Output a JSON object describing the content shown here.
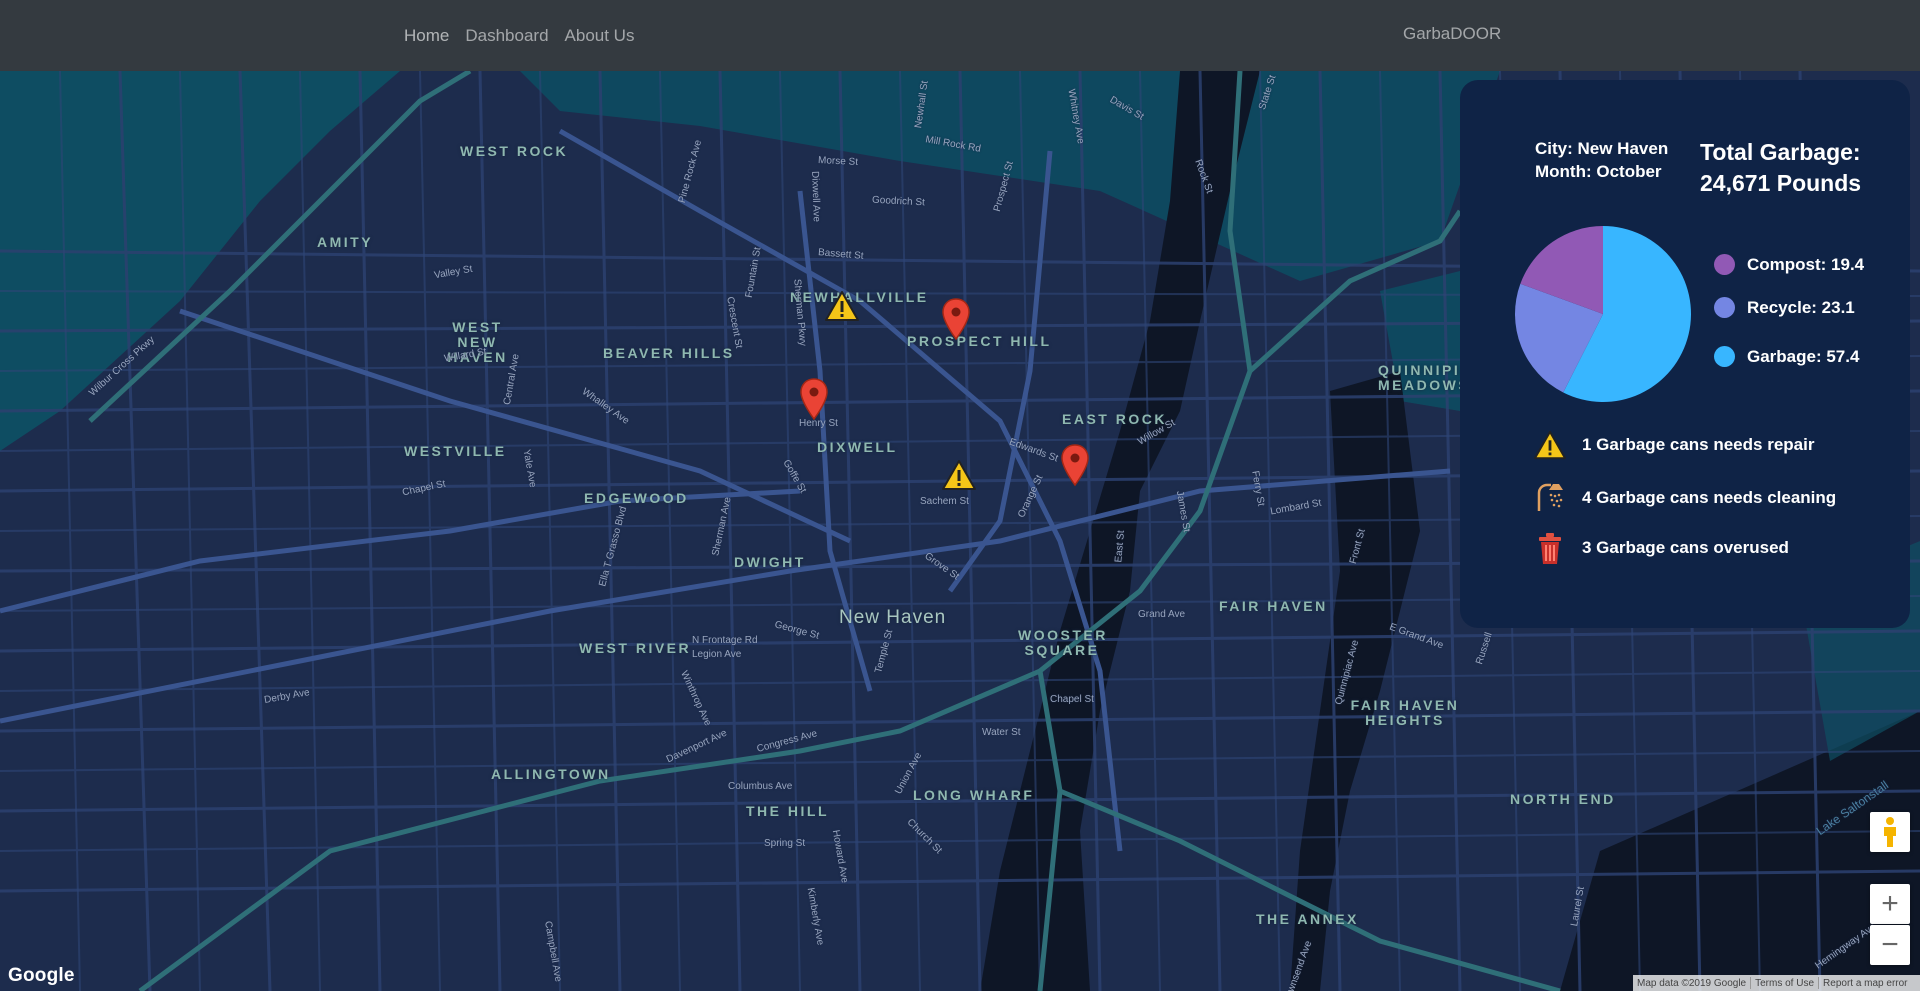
{
  "nav": {
    "links": [
      "Home",
      "Dashboard",
      "About Us"
    ],
    "brand": "GarbaDOOR"
  },
  "map": {
    "neighborhoods": [
      "WEST ROCK",
      "AMITY",
      "WEST NEW HAVEN",
      "BEAVER HILLS",
      "NEWHALLVILLE",
      "PROSPECT HILL",
      "WESTVILLE",
      "EDGEWOOD",
      "DIXWELL",
      "EAST ROCK",
      "DWIGHT",
      "New Haven",
      "WEST RIVER",
      "WOOSTER SQUARE",
      "FAIR HAVEN",
      "FAIR HAVEN HEIGHTS",
      "QUINNIPIAC MEADOWS",
      "ALLINGTOWN",
      "THE HILL",
      "LONG WHARF",
      "NORTH END",
      "THE ANNEX"
    ],
    "streets": [
      "Wilbur Cross Pkwy",
      "Valley St",
      "Willard St",
      "Central Ave",
      "Whalley Ave",
      "Yale Ave",
      "Chapel St",
      "Ella T Grasso Blvd",
      "Sherman Ave",
      "Crescent St",
      "Fountain St",
      "Sherman Pkwy",
      "Dixwell Ave",
      "Bassett St",
      "Goodrich St",
      "Morse St",
      "Pine Rock Ave",
      "Mill Rock Rd",
      "Newhall St",
      "Prospect St",
      "Whitney Ave",
      "Davis St",
      "State St",
      "Rock St",
      "Henry St",
      "Goffe St",
      "Edwards St",
      "Sachem St",
      "Orange St",
      "Willow St",
      "James St",
      "Ferry St",
      "Lombard St",
      "Front St",
      "Grand Ave",
      "E Grand Ave",
      "Russell",
      "Quinnipiac Ave",
      "George St",
      "N Frontage Rd",
      "Legion Ave",
      "Winthrop Ave",
      "Derby Ave",
      "Davenport Ave",
      "Congress Ave",
      "Columbus Ave",
      "Temple St",
      "Water St",
      "Union Ave",
      "Church St",
      "Howard Ave",
      "Kimberly Ave",
      "Spring St",
      "Campbell Ave",
      "Lake Saltonstall",
      "Laurel St",
      "Townsend Ave",
      "East St",
      "Grove St",
      "Chapel St",
      "Hemingway Ave"
    ],
    "attribution": [
      "Map data ©2019 Google",
      "Terms of Use",
      "Report a map error"
    ],
    "google_logo": "Google",
    "zoom_in": "+",
    "zoom_out": "−"
  },
  "panel": {
    "city": "City: New Haven",
    "month": "Month: October",
    "total_label": "Total Garbage:",
    "total_value": "24,671 Pounds",
    "legend": [
      {
        "label": "Compost: 19.4",
        "color": "#9159b5"
      },
      {
        "label": "Recycle: 23.1",
        "color": "#7486e3"
      },
      {
        "label": "Garbage: 57.4",
        "color": "#38b6ff"
      }
    ],
    "status": [
      {
        "text": "1 Garbage cans needs repair",
        "icon": "warning-icon"
      },
      {
        "text": "4 Garbage cans needs cleaning",
        "icon": "shower-icon"
      },
      {
        "text": "3 Garbage cans overused",
        "icon": "trash-icon"
      }
    ]
  },
  "chart_data": {
    "type": "pie",
    "categories": [
      "Compost",
      "Recycle",
      "Garbage"
    ],
    "values": [
      19.4,
      23.1,
      57.4
    ],
    "colors": [
      "#9159b5",
      "#7486e3",
      "#38b6ff"
    ]
  }
}
